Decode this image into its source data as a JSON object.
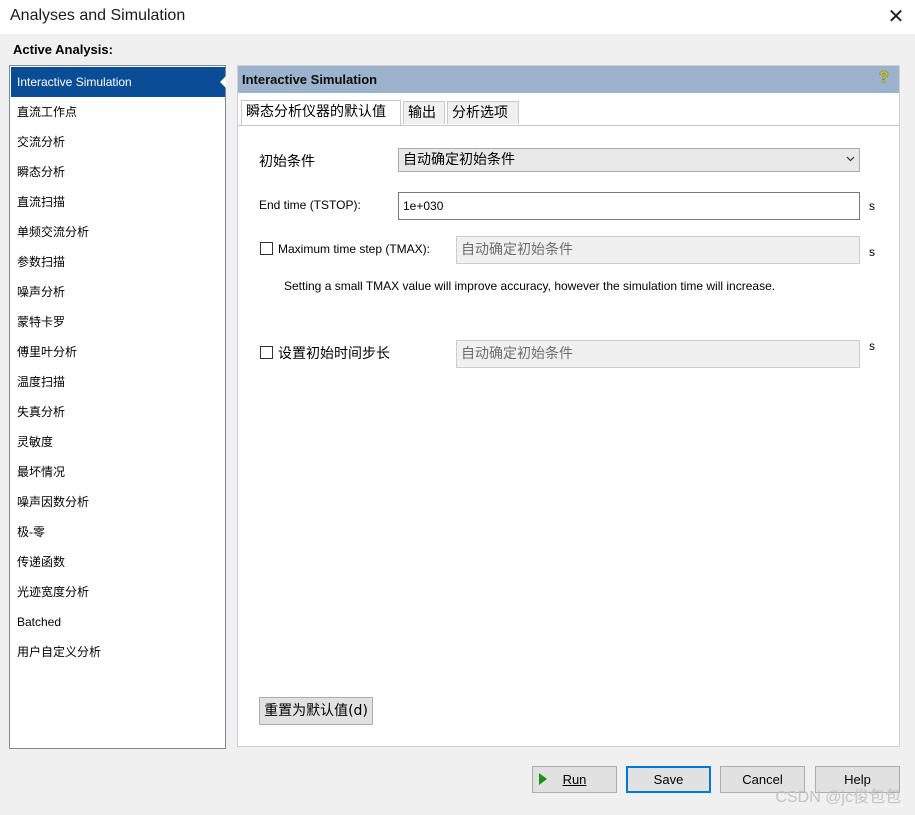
{
  "window": {
    "title": "Analyses and Simulation",
    "close_glyph": "✕"
  },
  "sidebar": {
    "label": "Active Analysis:",
    "items": [
      "Interactive Simulation",
      "直流工作点",
      "交流分析",
      "瞬态分析",
      "直流扫描",
      "单频交流分析",
      "参数扫描",
      "噪声分析",
      "蒙特卡罗",
      "傅里叶分析",
      "温度扫描",
      "失真分析",
      "灵敏度",
      "最坏情况",
      "噪声因数分析",
      "极-零",
      "传递函数",
      "光迹宽度分析",
      "Batched",
      "用户自定义分析"
    ],
    "selected_index": 0
  },
  "panel": {
    "title": "Interactive Simulation",
    "help_icon": "?",
    "tabs": [
      "瞬态分析仪器的默认值",
      "输出",
      "分析选项"
    ],
    "active_tab": 0,
    "initial_conditions": {
      "label": "初始条件",
      "value": "自动确定初始条件"
    },
    "end_time": {
      "label": "End time (TSTOP):",
      "value": "1e+030",
      "unit": "s"
    },
    "max_step": {
      "label": "Maximum time step (TMAX):",
      "value": "自动确定初始条件",
      "unit": "s",
      "checked": false
    },
    "hint": "Setting a small TMAX value will improve accuracy, however the simulation time will increase.",
    "initial_step": {
      "label": "设置初始时间步长",
      "value": "自动确定初始条件",
      "unit": "s",
      "checked": false
    },
    "reset_button": "重置为默认值(d)"
  },
  "footer": {
    "run": "Run",
    "save": "Save",
    "cancel": "Cancel",
    "help": "Help"
  },
  "watermark": "CSDN @jc俊包包",
  "colors": {
    "selection": "#0a4d96",
    "panel_header": "#9bb3cc",
    "accent": "#0078d7"
  }
}
